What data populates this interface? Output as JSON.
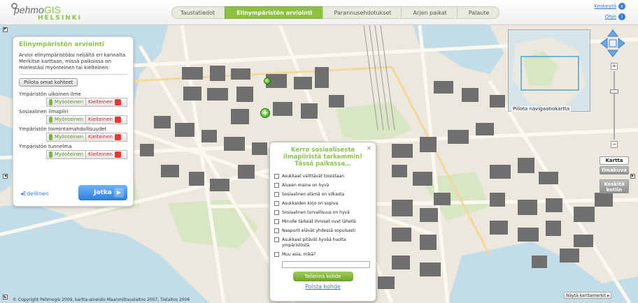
{
  "app": {
    "logo_prefix": "pehmo",
    "logo_suffix": "GIS",
    "logo_city": "HELSINKI"
  },
  "steps": [
    {
      "label": "Taustatiedot",
      "active": false
    },
    {
      "label": "Elinympäristön arviointi",
      "active": true
    },
    {
      "label": "Parannusehdotukset",
      "active": false
    },
    {
      "label": "Arjen paikat",
      "active": false
    },
    {
      "label": "Palaute",
      "active": false
    }
  ],
  "top_links": {
    "stop_label": "Keskeytä",
    "stop_icon": "x",
    "help_label": "Ohje",
    "help_icon": "i"
  },
  "left_panel": {
    "title": "Elinympäristön arviointi",
    "intro": "Arvioi elinympäristöäsi neljältä eri kannalta. Merkitse karttaan, missä paikoissa on mielestäsi myönteinen tai kielteinen:",
    "hide_button": "Piilota omat kohteet",
    "categories": [
      {
        "label": "Ympäristön ulkoinen ilme"
      },
      {
        "label": "Sosiaalinen ilmapiiri"
      },
      {
        "label": "Ympäristön toimintamahdollisuudet"
      },
      {
        "label": "Ympäristön tunnelma"
      }
    ],
    "positive_label": "Myönteinen",
    "negative_label": "Kielteinen",
    "back_label": "Edellinen",
    "next_label": "Jatka"
  },
  "popup": {
    "close_glyph": "×",
    "title_line1": "Kerro sosiaalisesta",
    "title_line2": "ilmapiiristä tarkemmin!",
    "title_line3": "Tässä paikassa…",
    "options": [
      "Asukkaat välittävät toisistaan",
      "Alueen maine on hyvä",
      "Sosiaalinen elämä on vilkasta",
      "Asukkaiden kirjo on sopiva",
      "Sosiaalinen turvallisuus on hyvä",
      "Minulle tärkeät ihmiset ovat lähellä",
      "Naapurit elävät yhdessä sopuisasti",
      "Asukkaat pitävät hyvää huolta ympäristöstä",
      "Muu asia, mikä?"
    ],
    "save_label": "Tallenna kohde",
    "delete_label": "Poista kohde"
  },
  "minimap": {
    "label": "Piilota navigaatiokartta"
  },
  "map_controls": {
    "zoom_in": "+",
    "zoom_out": "−",
    "map_label": "Kartta",
    "aerial_label": "Ilmakuva",
    "center_label_line1": "Keskitä",
    "center_label_line2": "kotiin"
  },
  "footer": {
    "copyright": "© Copyright Pehmogis 2009, kartta-aineisto Maanmittauslaitos 2007, Tielaitos 2006",
    "show_markers": "Näytä karttamerkit ▸"
  },
  "colors": {
    "accent_green": "#8dc13f",
    "link_blue": "#3a7bd5",
    "map_bg": "#ece8dd",
    "water": "#c3dcea"
  },
  "icons": [
    "pin-icon",
    "close-icon",
    "help-icon",
    "thumb-up-icon",
    "thumb-down-icon",
    "chevron-left-icon",
    "chevron-right-icon",
    "plus-icon",
    "pan-arrows-icon"
  ]
}
